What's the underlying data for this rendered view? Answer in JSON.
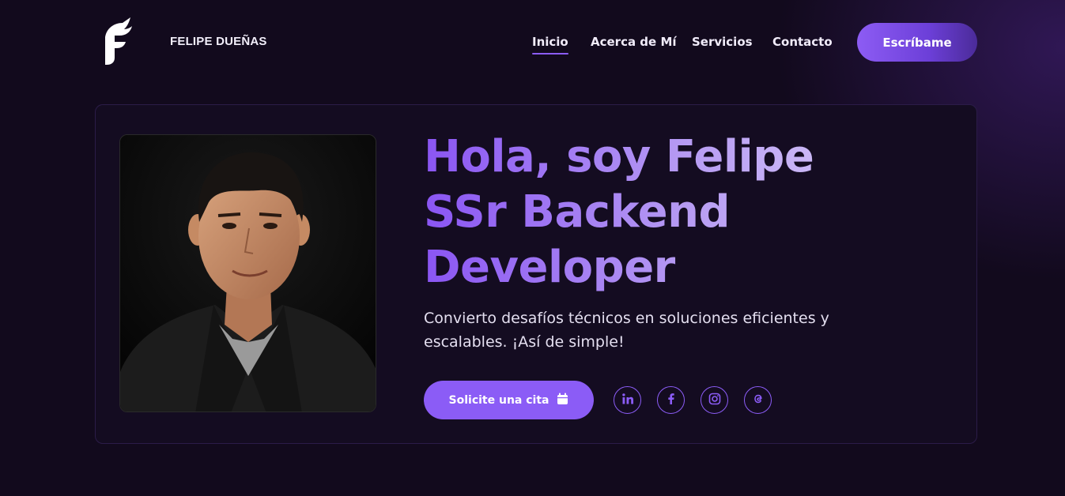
{
  "header": {
    "brand": "FELIPE DUEÑAS",
    "logo_icon": "feather-f-logo-icon",
    "nav": [
      {
        "label": "Inicio",
        "active": true
      },
      {
        "label": "Acerca de Mí",
        "active": false
      },
      {
        "label": "Servicios",
        "active": false
      },
      {
        "label": "Contacto",
        "active": false
      }
    ],
    "cta_label": "Escríbame"
  },
  "hero": {
    "headline_lines": [
      "Hola, soy Felipe",
      "SSr Backend",
      "Developer"
    ],
    "subtitle_lines": [
      "Convierto desafíos técnicos en soluciones eficientes y",
      "escalables. ¡Así de simple!"
    ],
    "cta_label": "Solicite una cita",
    "cta_icon": "calendar-icon",
    "socials": [
      {
        "icon": "linkedin-icon"
      },
      {
        "icon": "facebook-icon"
      },
      {
        "icon": "instagram-icon"
      },
      {
        "icon": "threads-icon"
      }
    ]
  },
  "colors": {
    "background": "#120a1d",
    "card": "#140c21",
    "accent": "#8b5cf6",
    "text": "#f1ecfa"
  }
}
